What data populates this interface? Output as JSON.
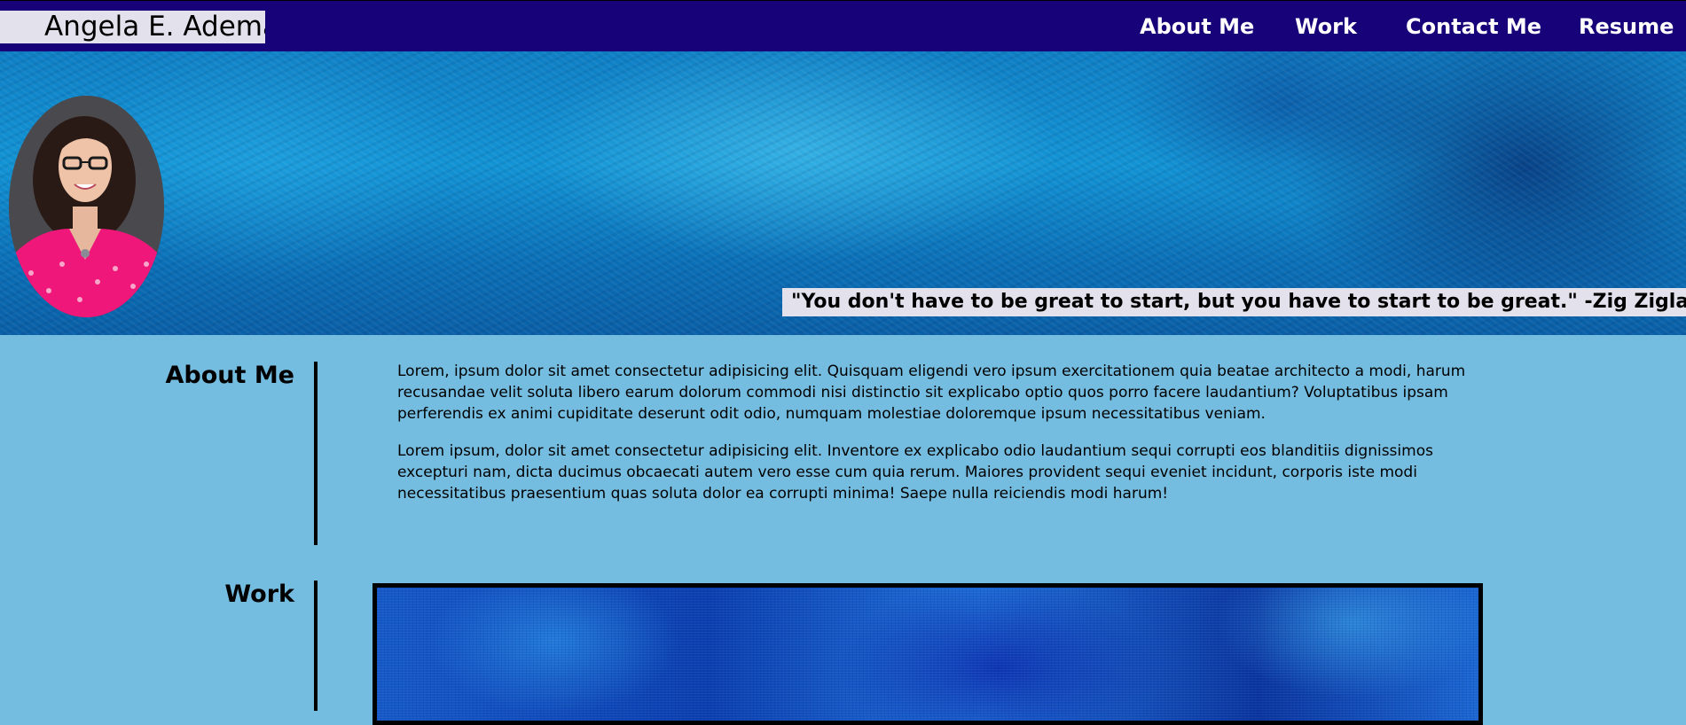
{
  "header": {
    "brand": "Angela E. Adema",
    "nav": [
      {
        "label": "About Me"
      },
      {
        "label": "Work"
      },
      {
        "label": "Contact Me"
      },
      {
        "label": "Resume"
      }
    ]
  },
  "hero": {
    "quote": "\"You don't have to be great to start, but you have to start to be great.\" -Zig Ziglar",
    "avatar_icon": "profile-photo"
  },
  "about": {
    "title": "About Me",
    "paragraphs": [
      "Lorem, ipsum dolor sit amet consectetur adipisicing elit. Quisquam eligendi vero ipsum exercitationem quia beatae architecto a modi, harum recusandae velit soluta libero earum dolorum commodi nisi distinctio sit explicabo optio quos porro facere laudantium? Voluptatibus ipsam perferendis ex animi cupiditate deserunt odit odio, numquam molestiae doloremque ipsum necessitatibus veniam.",
      "Lorem ipsum, dolor sit amet consectetur adipisicing elit. Inventore ex explicabo odio laudantium sequi corrupti eos blanditiis dignissimos excepturi nam, dicta ducimus obcaecati autem vero esse cum quia rerum. Maiores provident sequi eveniet incidunt, corporis iste modi necessitatibus praesentium quas soluta dolor ea corrupti minima! Saepe nulla reiciendis modi harum!"
    ]
  },
  "work": {
    "title": "Work"
  },
  "colors": {
    "nav_background": "#170279",
    "page_background": "#75bde0",
    "label_background": "#e2e1ec",
    "accent_pink": "#f0177a"
  }
}
